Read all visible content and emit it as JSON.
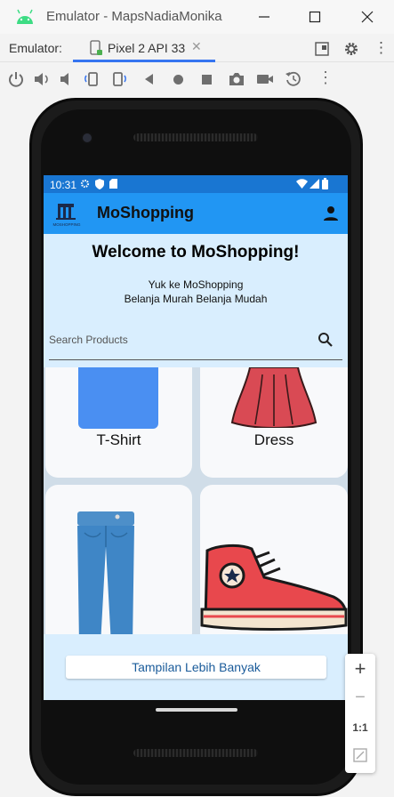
{
  "window": {
    "title": "Emulator - MapsNadiaMonika",
    "minimize_icon": "minimize-icon",
    "maximize_icon": "maximize-icon",
    "close_icon": "close-icon"
  },
  "tabbar": {
    "label": "Emulator:",
    "tab_label": "Pixel 2 API 33",
    "accent": "#3574f0"
  },
  "toolbar": {
    "icons": [
      "power-icon",
      "volume-up-icon",
      "volume-down-icon",
      "rotate-left-icon",
      "rotate-right-icon",
      "back-icon",
      "home-icon",
      "overview-icon",
      "screenshot-icon",
      "record-icon",
      "snapshot-icon",
      "more-icon"
    ]
  },
  "device": {
    "status": {
      "time": "10:31"
    },
    "app": {
      "title": "MoShopping",
      "logo_text": "MOSHOPPING",
      "colors": {
        "status": "#1976d2",
        "appbar": "#2196f3",
        "header": "#d9eefe",
        "button_text": "#1a5b9a"
      }
    },
    "header": {
      "welcome": "Welcome to MoShopping!",
      "tagline_1": "Yuk ke MoShopping",
      "tagline_2": "Belanja Murah Belanja Mudah"
    },
    "search": {
      "placeholder": "Search Products"
    },
    "products": [
      {
        "name": "T-Shirt"
      },
      {
        "name": "Dress"
      },
      {
        "name": "Jeans"
      },
      {
        "name": "Sneakers"
      }
    ],
    "more_button": "Tampilan Lebih Banyak"
  },
  "zoom": {
    "plus": "+",
    "minus": "−",
    "ratio": "1:1"
  }
}
